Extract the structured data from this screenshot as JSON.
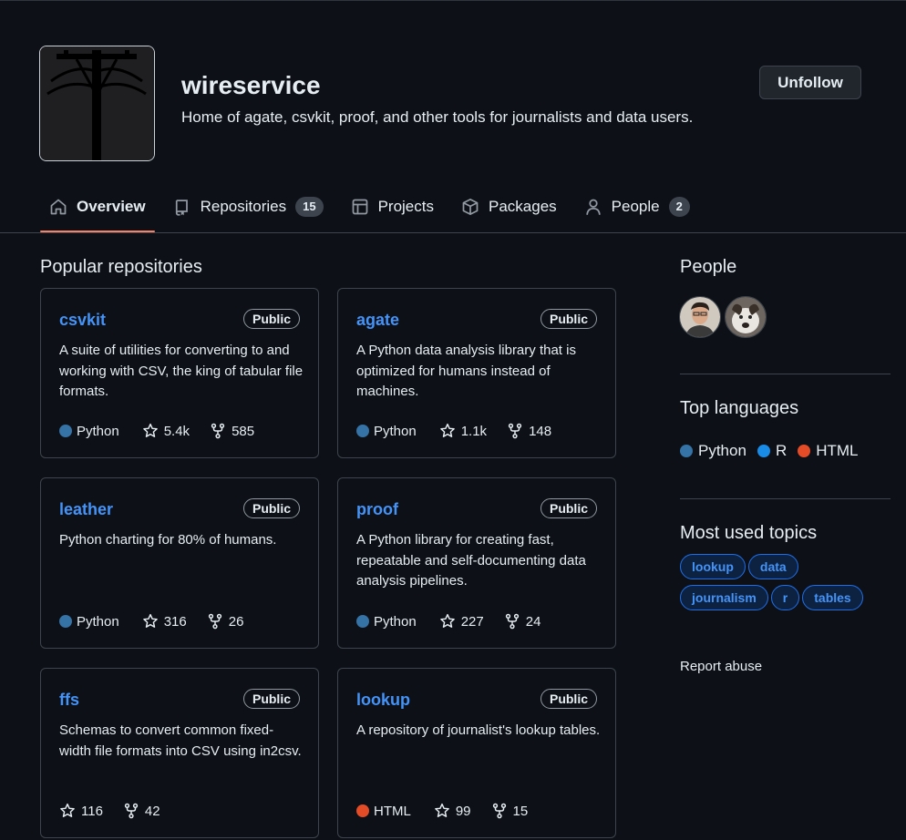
{
  "org": {
    "name": "wireservice",
    "description": "Home of agate, csvkit, proof, and other tools for journalists and data users.",
    "follow_label": "Unfollow"
  },
  "tabs": [
    {
      "label": "Overview",
      "icon": "home-icon",
      "active": true
    },
    {
      "label": "Repositories",
      "icon": "repo-icon",
      "count": "15"
    },
    {
      "label": "Projects",
      "icon": "table-icon"
    },
    {
      "label": "Packages",
      "icon": "package-icon"
    },
    {
      "label": "People",
      "icon": "person-icon",
      "count": "2"
    }
  ],
  "popular": {
    "title": "Popular repositories",
    "repos": [
      {
        "name": "csvkit",
        "visibility": "Public",
        "description": "A suite of utilities for converting to and working with CSV, the king of tabular file formats.",
        "language": "Python",
        "stars": "5.4k",
        "forks": "585"
      },
      {
        "name": "agate",
        "visibility": "Public",
        "description": "A Python data analysis library that is optimized for humans instead of machines.",
        "language": "Python",
        "stars": "1.1k",
        "forks": "148"
      },
      {
        "name": "leather",
        "visibility": "Public",
        "description": "Python charting for 80% of humans.",
        "language": "Python",
        "stars": "316",
        "forks": "26"
      },
      {
        "name": "proof",
        "visibility": "Public",
        "description": "A Python library for creating fast, repeatable and self-documenting data analysis pipelines.",
        "language": "Python",
        "stars": "227",
        "forks": "24"
      },
      {
        "name": "ffs",
        "visibility": "Public",
        "description": "Schemas to convert common fixed-width file formats into CSV using in2csv.",
        "language": "",
        "stars": "116",
        "forks": "42"
      },
      {
        "name": "lookup",
        "visibility": "Public",
        "description": "A repository of journalist's lookup tables.",
        "language": "HTML",
        "stars": "99",
        "forks": "15"
      }
    ]
  },
  "sidebar": {
    "people_title": "People",
    "languages_title": "Top languages",
    "languages": [
      {
        "name": "Python",
        "color": "#3572A5"
      },
      {
        "name": "R",
        "color": "#198CE7"
      },
      {
        "name": "HTML",
        "color": "#e34c26"
      }
    ],
    "topics_title": "Most used topics",
    "topics": [
      "lookup",
      "data",
      "journalism",
      "r",
      "tables"
    ],
    "report": "Report abuse"
  },
  "colors": {
    "accent": "#4493f8",
    "tab_underline": "#f78166",
    "python": "#3572A5",
    "html": "#e34c26"
  }
}
